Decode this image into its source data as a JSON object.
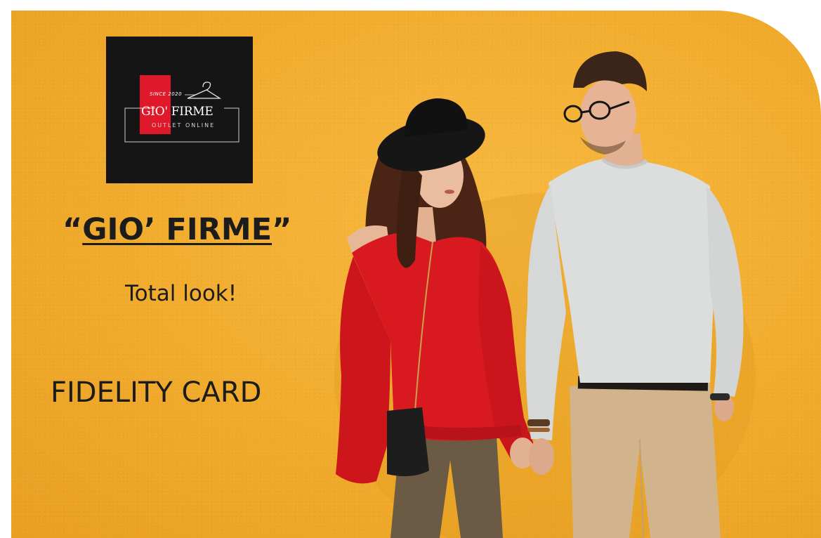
{
  "logo": {
    "since": "SINCE 2020",
    "name": "GIO' FIRME",
    "subtitle": "OUTLET ONLINE"
  },
  "headline": {
    "quote_open": "“",
    "brand": "GIO’ FIRME",
    "quote_close": "”"
  },
  "tagline": "Total look!",
  "card_label": "FIDELITY CARD",
  "colors": {
    "background": "#f1ab2c",
    "logo_bg": "#151515",
    "logo_accent": "#e0192a",
    "sweater_red": "#d8191f",
    "sweater_grey": "#dcdedd",
    "chinos": "#d2b48c"
  }
}
